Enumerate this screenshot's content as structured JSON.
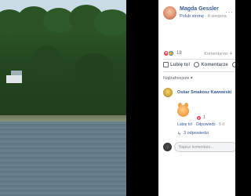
{
  "post": {
    "author": "Magda Gessler",
    "meta_prefix": "Polub stronę",
    "meta_separator": " · ",
    "date": "8 sierpnia",
    "more_icon": "ellipsis-icon"
  },
  "reactions": {
    "types": [
      "heart",
      "like"
    ],
    "count": "18",
    "comments_label": "Komentarze: 4"
  },
  "actions": {
    "like_label": "Lubię to!",
    "comment_label": "Komentarze",
    "share_label": "U"
  },
  "comments_sort": "Najtrafniejsze ▾",
  "comment": {
    "author": "Oskar Smakosz Kawowski",
    "reaction_count": "1",
    "like_label": "Lubię to!",
    "reply_label": "Odpowiedz",
    "time": "5 d",
    "separator": " · ",
    "replies_label": "3 odpowiedzi"
  },
  "composer": {
    "placeholder": "Napisz komentarz..."
  },
  "colors": {
    "link": "#365899",
    "heart": "#f33e58",
    "like": "#1877f2",
    "muted": "#90949c"
  }
}
